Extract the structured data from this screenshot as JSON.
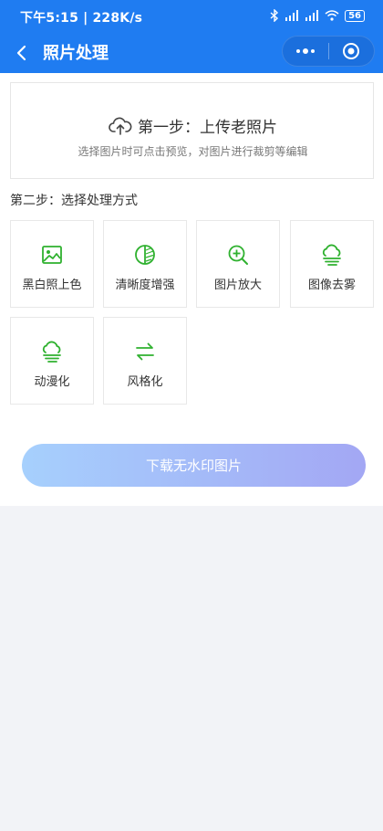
{
  "status": {
    "time_speed": "下午5:15 | 228K/s",
    "battery": "56"
  },
  "navbar": {
    "title": "照片处理"
  },
  "upload": {
    "title": "第一步：上传老照片",
    "subtitle": "选择图片时可点击预览，对图片进行裁剪等编辑"
  },
  "step2": {
    "title": "第二步：选择处理方式"
  },
  "options": [
    {
      "label": "黑白照上色",
      "icon": "image-icon"
    },
    {
      "label": "清晰度增强",
      "icon": "contrast-icon"
    },
    {
      "label": "图片放大",
      "icon": "zoom-in-icon"
    },
    {
      "label": "图像去雾",
      "icon": "fog-icon"
    },
    {
      "label": "动漫化",
      "icon": "fog-icon"
    },
    {
      "label": "风格化",
      "icon": "swap-icon"
    }
  ],
  "actions": {
    "download_label": "下载无水印图片"
  },
  "colors": {
    "primary": "#1f7cf1",
    "icon_green": "#2fb12f",
    "button_gradient_start": "#a6d0fd",
    "button_gradient_end": "#a3a7f4"
  }
}
